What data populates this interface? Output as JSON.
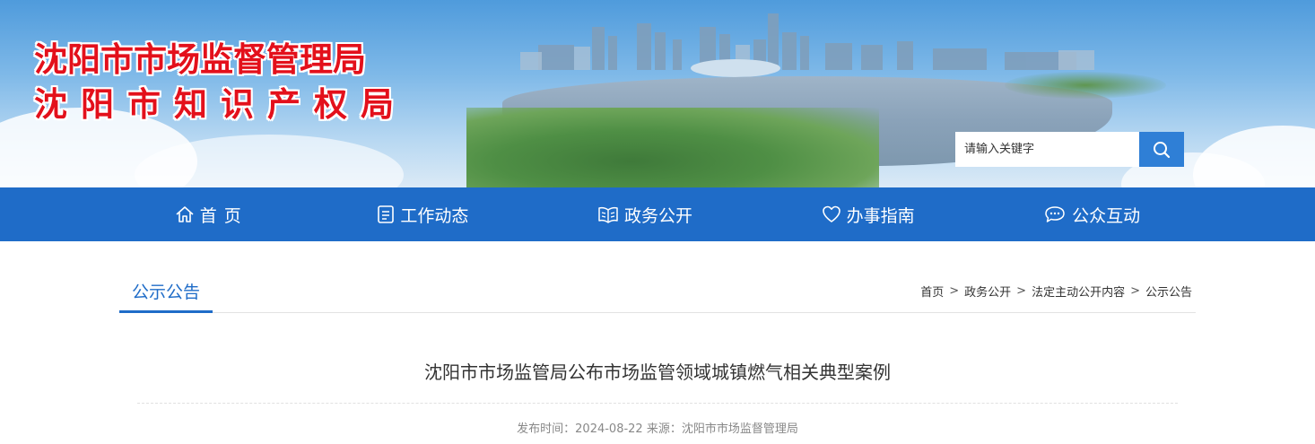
{
  "logo": {
    "line1": "沈阳市市场监督管理局",
    "line2": "沈阳市知识产权局"
  },
  "search": {
    "placeholder": "请输入关键字",
    "icon": "search-icon"
  },
  "nav": {
    "items": [
      {
        "label": "首页",
        "icon": "home-icon"
      },
      {
        "label": "工作动态",
        "icon": "document-icon"
      },
      {
        "label": "政务公开",
        "icon": "book-icon"
      },
      {
        "label": "办事指南",
        "icon": "heart-icon"
      },
      {
        "label": "公众互动",
        "icon": "chat-icon"
      }
    ]
  },
  "section": {
    "title": "公示公告"
  },
  "breadcrumb": {
    "items": [
      "首页",
      "政务公开",
      "法定主动公开内容",
      "公示公告"
    ],
    "separator": ">"
  },
  "article": {
    "title": "沈阳市市场监管局公布市场监管领域城镇燃气相关典型案例",
    "meta": "发布时间：2024-08-22 来源：沈阳市市场监督管理局"
  },
  "colors": {
    "nav_bg": "#1f6cc8",
    "logo_red": "#e3101b",
    "accent_blue": "#1f6cc8"
  }
}
